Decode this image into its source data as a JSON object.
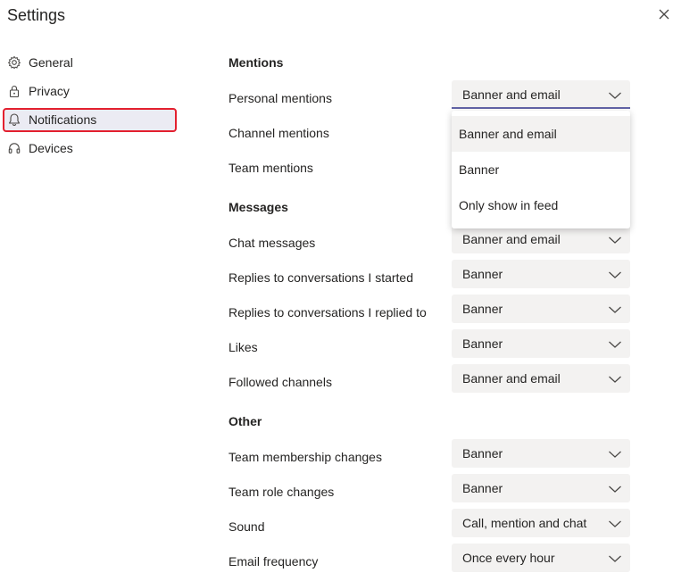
{
  "dialog": {
    "title": "Settings"
  },
  "sidebar": {
    "items": [
      {
        "label": "General",
        "icon": "gear-icon"
      },
      {
        "label": "Privacy",
        "icon": "lock-icon"
      },
      {
        "label": "Notifications",
        "icon": "bell-icon",
        "selected": true
      },
      {
        "label": "Devices",
        "icon": "headset-icon"
      }
    ]
  },
  "mentions": {
    "heading": "Mentions",
    "rows": [
      {
        "label": "Personal mentions",
        "value": "Banner and email",
        "open": true
      },
      {
        "label": "Channel mentions"
      },
      {
        "label": "Team mentions"
      }
    ]
  },
  "dropdown": {
    "options": [
      "Banner and email",
      "Banner",
      "Only show in feed"
    ],
    "selected": "Banner and email"
  },
  "messages": {
    "heading": "Messages",
    "rows": [
      {
        "label": "Chat messages",
        "value": "Banner and email"
      },
      {
        "label": "Replies to conversations I started",
        "value": "Banner"
      },
      {
        "label": "Replies to conversations I replied to",
        "value": "Banner"
      },
      {
        "label": "Likes",
        "value": "Banner"
      },
      {
        "label": "Followed channels",
        "value": "Banner and email"
      }
    ]
  },
  "other": {
    "heading": "Other",
    "rows": [
      {
        "label": "Team membership changes",
        "value": "Banner"
      },
      {
        "label": "Team role changes",
        "value": "Banner"
      },
      {
        "label": "Sound",
        "value": "Call, mention and chat"
      },
      {
        "label": "Email frequency",
        "value": "Once every hour"
      }
    ]
  },
  "colors": {
    "accent": "#6264a7",
    "highlight": "#e3202f",
    "field_bg": "#f3f2f1"
  }
}
